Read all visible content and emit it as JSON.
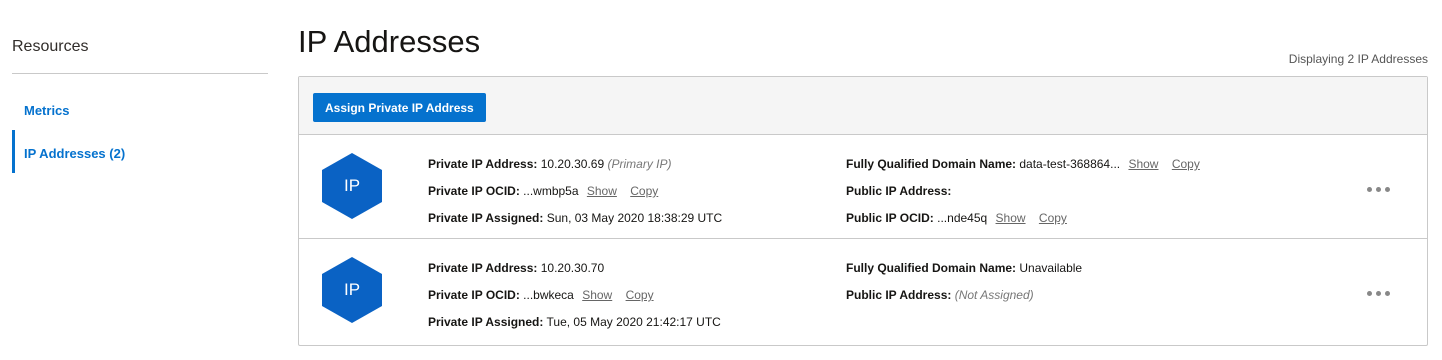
{
  "sidebar": {
    "heading": "Resources",
    "items": [
      {
        "label": "Metrics"
      },
      {
        "label": "IP Addresses (2)"
      }
    ]
  },
  "main": {
    "title": "IP Addresses",
    "display_count": "Displaying 2 IP Addresses",
    "assign_button": "Assign Private IP Address"
  },
  "labels": {
    "private_ip_address": "Private IP Address:",
    "private_ip_ocid": "Private IP OCID:",
    "private_ip_assigned": "Private IP Assigned:",
    "fqdn": "Fully Qualified Domain Name:",
    "public_ip_address": "Public IP Address:",
    "public_ip_ocid": "Public IP OCID:",
    "show": "Show",
    "copy": "Copy",
    "icon_text": "IP"
  },
  "rows": [
    {
      "private_ip": "10.20.30.69",
      "private_ip_note": "(Primary IP)",
      "private_ocid": "...wmbp5a",
      "assigned": "Sun, 03 May 2020 18:38:29 UTC",
      "fqdn": "data-test-368864...",
      "public_ip": "",
      "public_ocid": "...nde45q"
    },
    {
      "private_ip": "10.20.30.70",
      "private_ocid": "...bwkeca",
      "assigned": "Tue, 05 May 2020 21:42:17 UTC",
      "fqdn": "Unavailable",
      "public_ip_note": "(Not Assigned)"
    }
  ],
  "colors": {
    "accent": "#0572ce",
    "hex_fill": "#0a62c4"
  },
  "icons": {
    "resource_icon": "hexagon-ip-icon",
    "actions_icon": "kebab-menu-icon"
  }
}
